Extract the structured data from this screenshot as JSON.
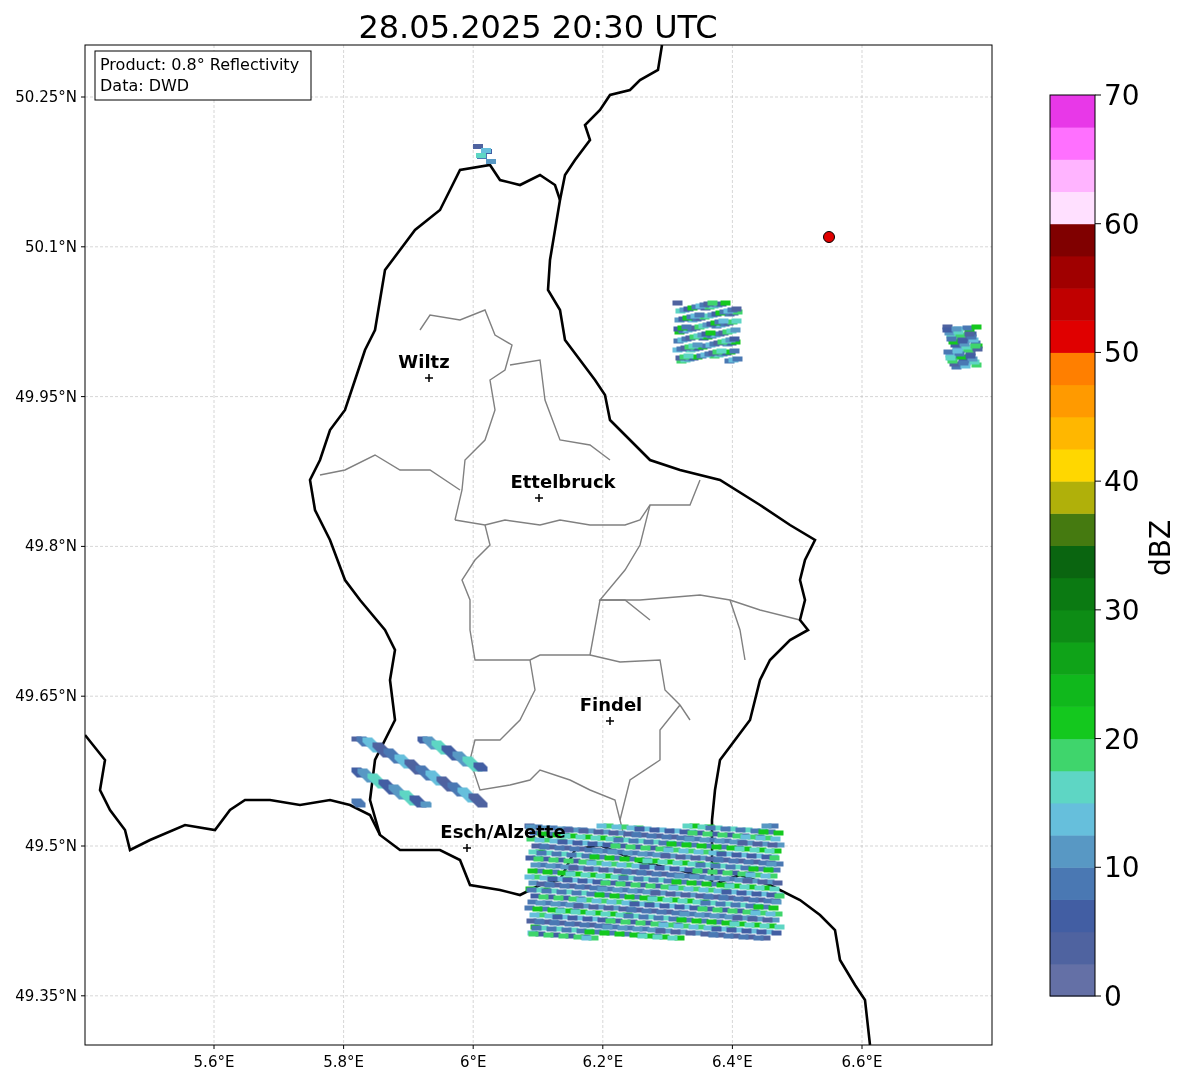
{
  "title": "28.05.2025 20:30 UTC",
  "info_box": [
    "Product: 0.8° Reflectivity",
    "Data: DWD"
  ],
  "y_ticks": [
    "50.25°N",
    "50.1°N",
    "49.95°N",
    "49.8°N",
    "49.65°N",
    "49.5°N",
    "49.35°N"
  ],
  "x_ticks": [
    "5.6°E",
    "5.8°E",
    "6°E",
    "6.2°E",
    "6.4°E",
    "6.6°E"
  ],
  "cities": [
    {
      "name": "Wiltz"
    },
    {
      "name": "Ettelbruck"
    },
    {
      "name": "Findel"
    },
    {
      "name": "Esch/Alzette"
    }
  ],
  "colorbar": {
    "label": "dBZ",
    "ticks": [
      "70",
      "60",
      "50",
      "40",
      "30",
      "20",
      "10",
      "0"
    ],
    "segments": [
      {
        "color": "#6470a6"
      },
      {
        "color": "#4f63a0"
      },
      {
        "color": "#425ea3"
      },
      {
        "color": "#4a78b3"
      },
      {
        "color": "#5898c4"
      },
      {
        "color": "#66bfdc"
      },
      {
        "color": "#5ed6c4"
      },
      {
        "color": "#3fd56c"
      },
      {
        "color": "#14c81e"
      },
      {
        "color": "#10b81c"
      },
      {
        "color": "#0fa318"
      },
      {
        "color": "#0d8c15"
      },
      {
        "color": "#0b7a12"
      },
      {
        "color": "#0a6510"
      },
      {
        "color": "#457a10"
      },
      {
        "color": "#b0b00a"
      },
      {
        "color": "#ffd700"
      },
      {
        "color": "#ffb700"
      },
      {
        "color": "#ff9a00"
      },
      {
        "color": "#ff7f00"
      },
      {
        "color": "#e00000"
      },
      {
        "color": "#c00000"
      },
      {
        "color": "#a00000"
      },
      {
        "color": "#800000"
      },
      {
        "color": "#ffe0ff"
      },
      {
        "color": "#ffb4ff"
      },
      {
        "color": "#ff70ff"
      },
      {
        "color": "#e838e8"
      }
    ]
  }
}
